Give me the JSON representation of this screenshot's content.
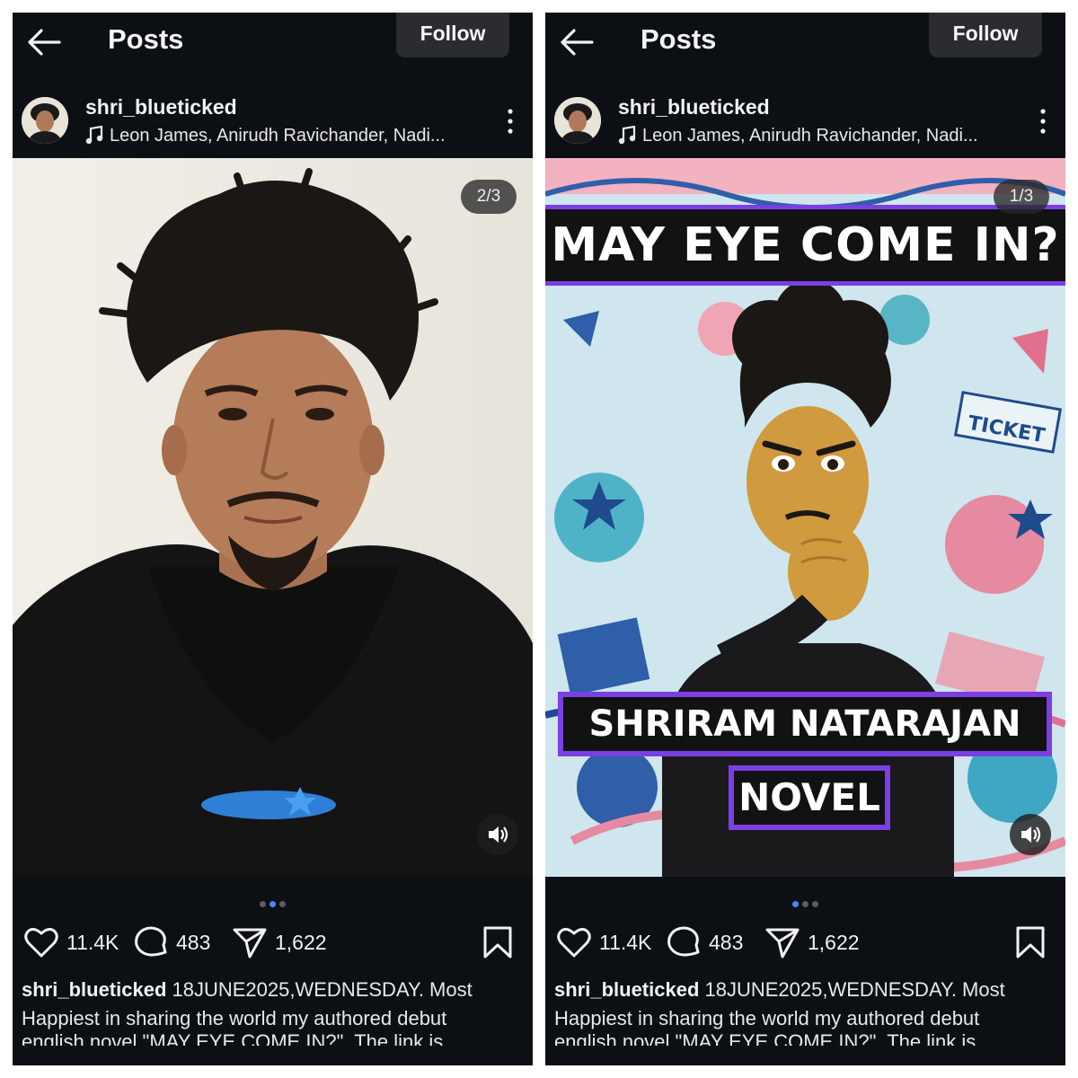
{
  "panels": [
    {
      "header": {
        "title": "Posts",
        "follow_label": "Follow"
      },
      "author": {
        "username": "shri_blueticked",
        "music": "Leon James, Anirudh Ravichander, Nadi..."
      },
      "media": {
        "counter": "2/3",
        "kind": "photo"
      },
      "carousel": {
        "active_index": 1,
        "total": 3
      },
      "stats": {
        "likes": "11.4K",
        "comments": "483",
        "shares": "1,622"
      },
      "caption": {
        "username": "shri_blueticked",
        "text": "18JUNE2025,WEDNESDAY. Most Happiest in sharing the world my authored debut",
        "cut_line": "english novel \"MAY EYE COME IN?\". The link is"
      }
    },
    {
      "header": {
        "title": "Posts",
        "follow_label": "Follow"
      },
      "author": {
        "username": "shri_blueticked",
        "music": "Leon James, Anirudh Ravichander, Nadi..."
      },
      "media": {
        "counter": "1/3",
        "kind": "poster",
        "poster_title": "MAY EYE COME IN?",
        "poster_author": "SHRIRAM  NATARAJAN",
        "poster_genre": "NOVEL",
        "ticket_text": "TICKET"
      },
      "carousel": {
        "active_index": 0,
        "total": 3
      },
      "stats": {
        "likes": "11.4K",
        "comments": "483",
        "shares": "1,622"
      },
      "caption": {
        "username": "shri_blueticked",
        "text": "18JUNE2025,WEDNESDAY. Most Happiest in sharing the world my authored debut",
        "cut_line": "english novel \"MAY EYE COME IN?\". The link is"
      }
    }
  ],
  "colors": {
    "background": "#0c0f14",
    "accent_dot": "#4a86f0",
    "poster_border": "#7b3fe4"
  }
}
